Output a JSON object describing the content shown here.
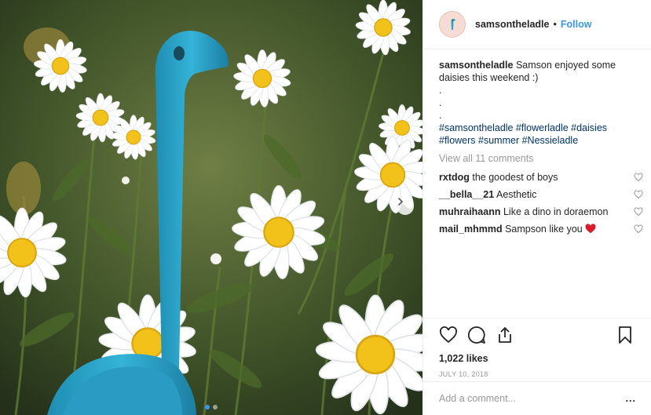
{
  "header": {
    "username": "samsontheladle",
    "separator": "•",
    "follow_label": "Follow"
  },
  "caption": {
    "username": "samsontheladle",
    "text": "Samson enjoyed some daisies this weekend :)",
    "dots": [
      ".",
      ".",
      "."
    ],
    "hashtags_line1": "#samsontheladle #flowerladle #daisies",
    "hashtags_line2": "#flowers #summer #Nessieladle"
  },
  "view_all": "View all 11 comments",
  "comments": [
    {
      "user": "rxtdog",
      "text": "the goodest of boys"
    },
    {
      "user": "__bella__21",
      "text": "Aesthetic"
    },
    {
      "user": "muhraihaann",
      "text": "Like a dino in doraemon"
    },
    {
      "user": "mail_mhmmd",
      "text": "Sampson like you"
    }
  ],
  "likes": "1,022 likes",
  "date": "JULY 10, 2018",
  "add_comment_placeholder": "Add a comment...",
  "more_label": "...",
  "carousel": {
    "total": 2,
    "active": 1
  },
  "colors": {
    "accent": "#3897f0",
    "ladle": "#2ea4c9",
    "daisy_center": "#f2c21b",
    "heart": "#ed4956"
  },
  "icons": [
    "heart-icon",
    "comment-icon",
    "share-icon",
    "bookmark-icon",
    "chevron-right-icon"
  ]
}
